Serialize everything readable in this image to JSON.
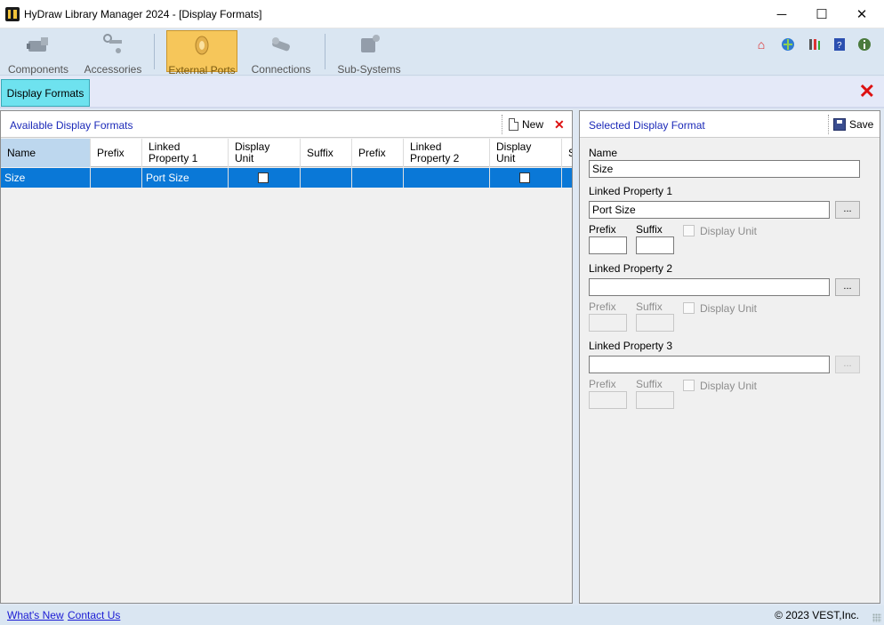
{
  "window": {
    "title": "HyDraw Library Manager 2024 - [Display Formats]",
    "minimize": "─",
    "maximize": "☐",
    "close": "✕"
  },
  "toolbar": {
    "items": [
      {
        "label": "Components",
        "icon": "components-icon"
      },
      {
        "label": "Accessories",
        "icon": "accessories-icon"
      },
      {
        "label": "External Ports",
        "icon": "external-ports-icon",
        "active": true
      },
      {
        "label": "Connections",
        "icon": "connections-icon"
      },
      {
        "label": "Sub-Systems",
        "icon": "sub-systems-icon"
      }
    ],
    "right_icons": [
      "home-icon",
      "web-update-icon",
      "tools-icon",
      "help-book-icon",
      "info-icon"
    ]
  },
  "tabs": {
    "active": "Display Formats"
  },
  "left_panel": {
    "title": "Available Display Formats",
    "new_label": "New",
    "columns": [
      "Name",
      "Prefix",
      "Linked\nProperty 1",
      "Display\nUnit",
      "Suffix",
      "Prefix",
      "Linked\nProperty 2",
      "Display\nUnit",
      "S"
    ],
    "rows": [
      {
        "name": "Size",
        "prefix": "",
        "linked_property_1": "Port Size",
        "display_unit": false,
        "suffix": "",
        "prefix_2": "",
        "linked_property_2": "",
        "display_unit_2": false
      }
    ]
  },
  "right_panel": {
    "title": "Selected Display Format",
    "save_label": "Save",
    "name_label": "Name",
    "name_value": "Size",
    "lp1_label": "Linked Property 1",
    "lp1_value": "Port Size",
    "lp2_label": "Linked Property 2",
    "lp2_value": "",
    "lp3_label": "Linked Property 3",
    "lp3_value": "",
    "prefix_label": "Prefix",
    "suffix_label": "Suffix",
    "display_unit_label": "Display Unit",
    "browse_label": "..."
  },
  "status": {
    "whats_new": "What's New",
    "contact_us": "Contact Us",
    "copyright": "© 2023 VEST,Inc."
  }
}
